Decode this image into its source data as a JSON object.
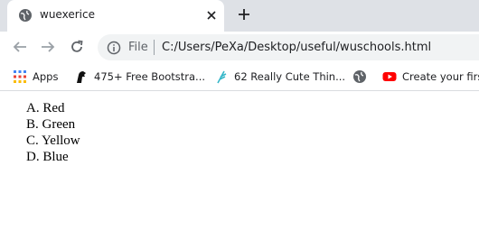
{
  "tab": {
    "title": "wuexerice",
    "icon": "globe-icon"
  },
  "toolbar": {
    "file_label": "File",
    "url": "C:/Users/PeXa/Desktop/useful/wuschools.html"
  },
  "bookmarks": [
    {
      "label": "Apps",
      "icon": "apps-grid-icon"
    },
    {
      "label": "475+ Free Bootstra...",
      "icon": "bootstrap-horse-icon"
    },
    {
      "label": "62 Really Cute Thin...",
      "icon": "feather-icon"
    },
    {
      "label": "",
      "icon": "globe-icon"
    },
    {
      "label": "Create your first",
      "icon": "youtube-icon"
    }
  ],
  "options": [
    {
      "letter": "A.",
      "text": "Red"
    },
    {
      "letter": "B.",
      "text": "Green"
    },
    {
      "letter": "C.",
      "text": "Yellow"
    },
    {
      "letter": "D.",
      "text": "Blue"
    }
  ]
}
